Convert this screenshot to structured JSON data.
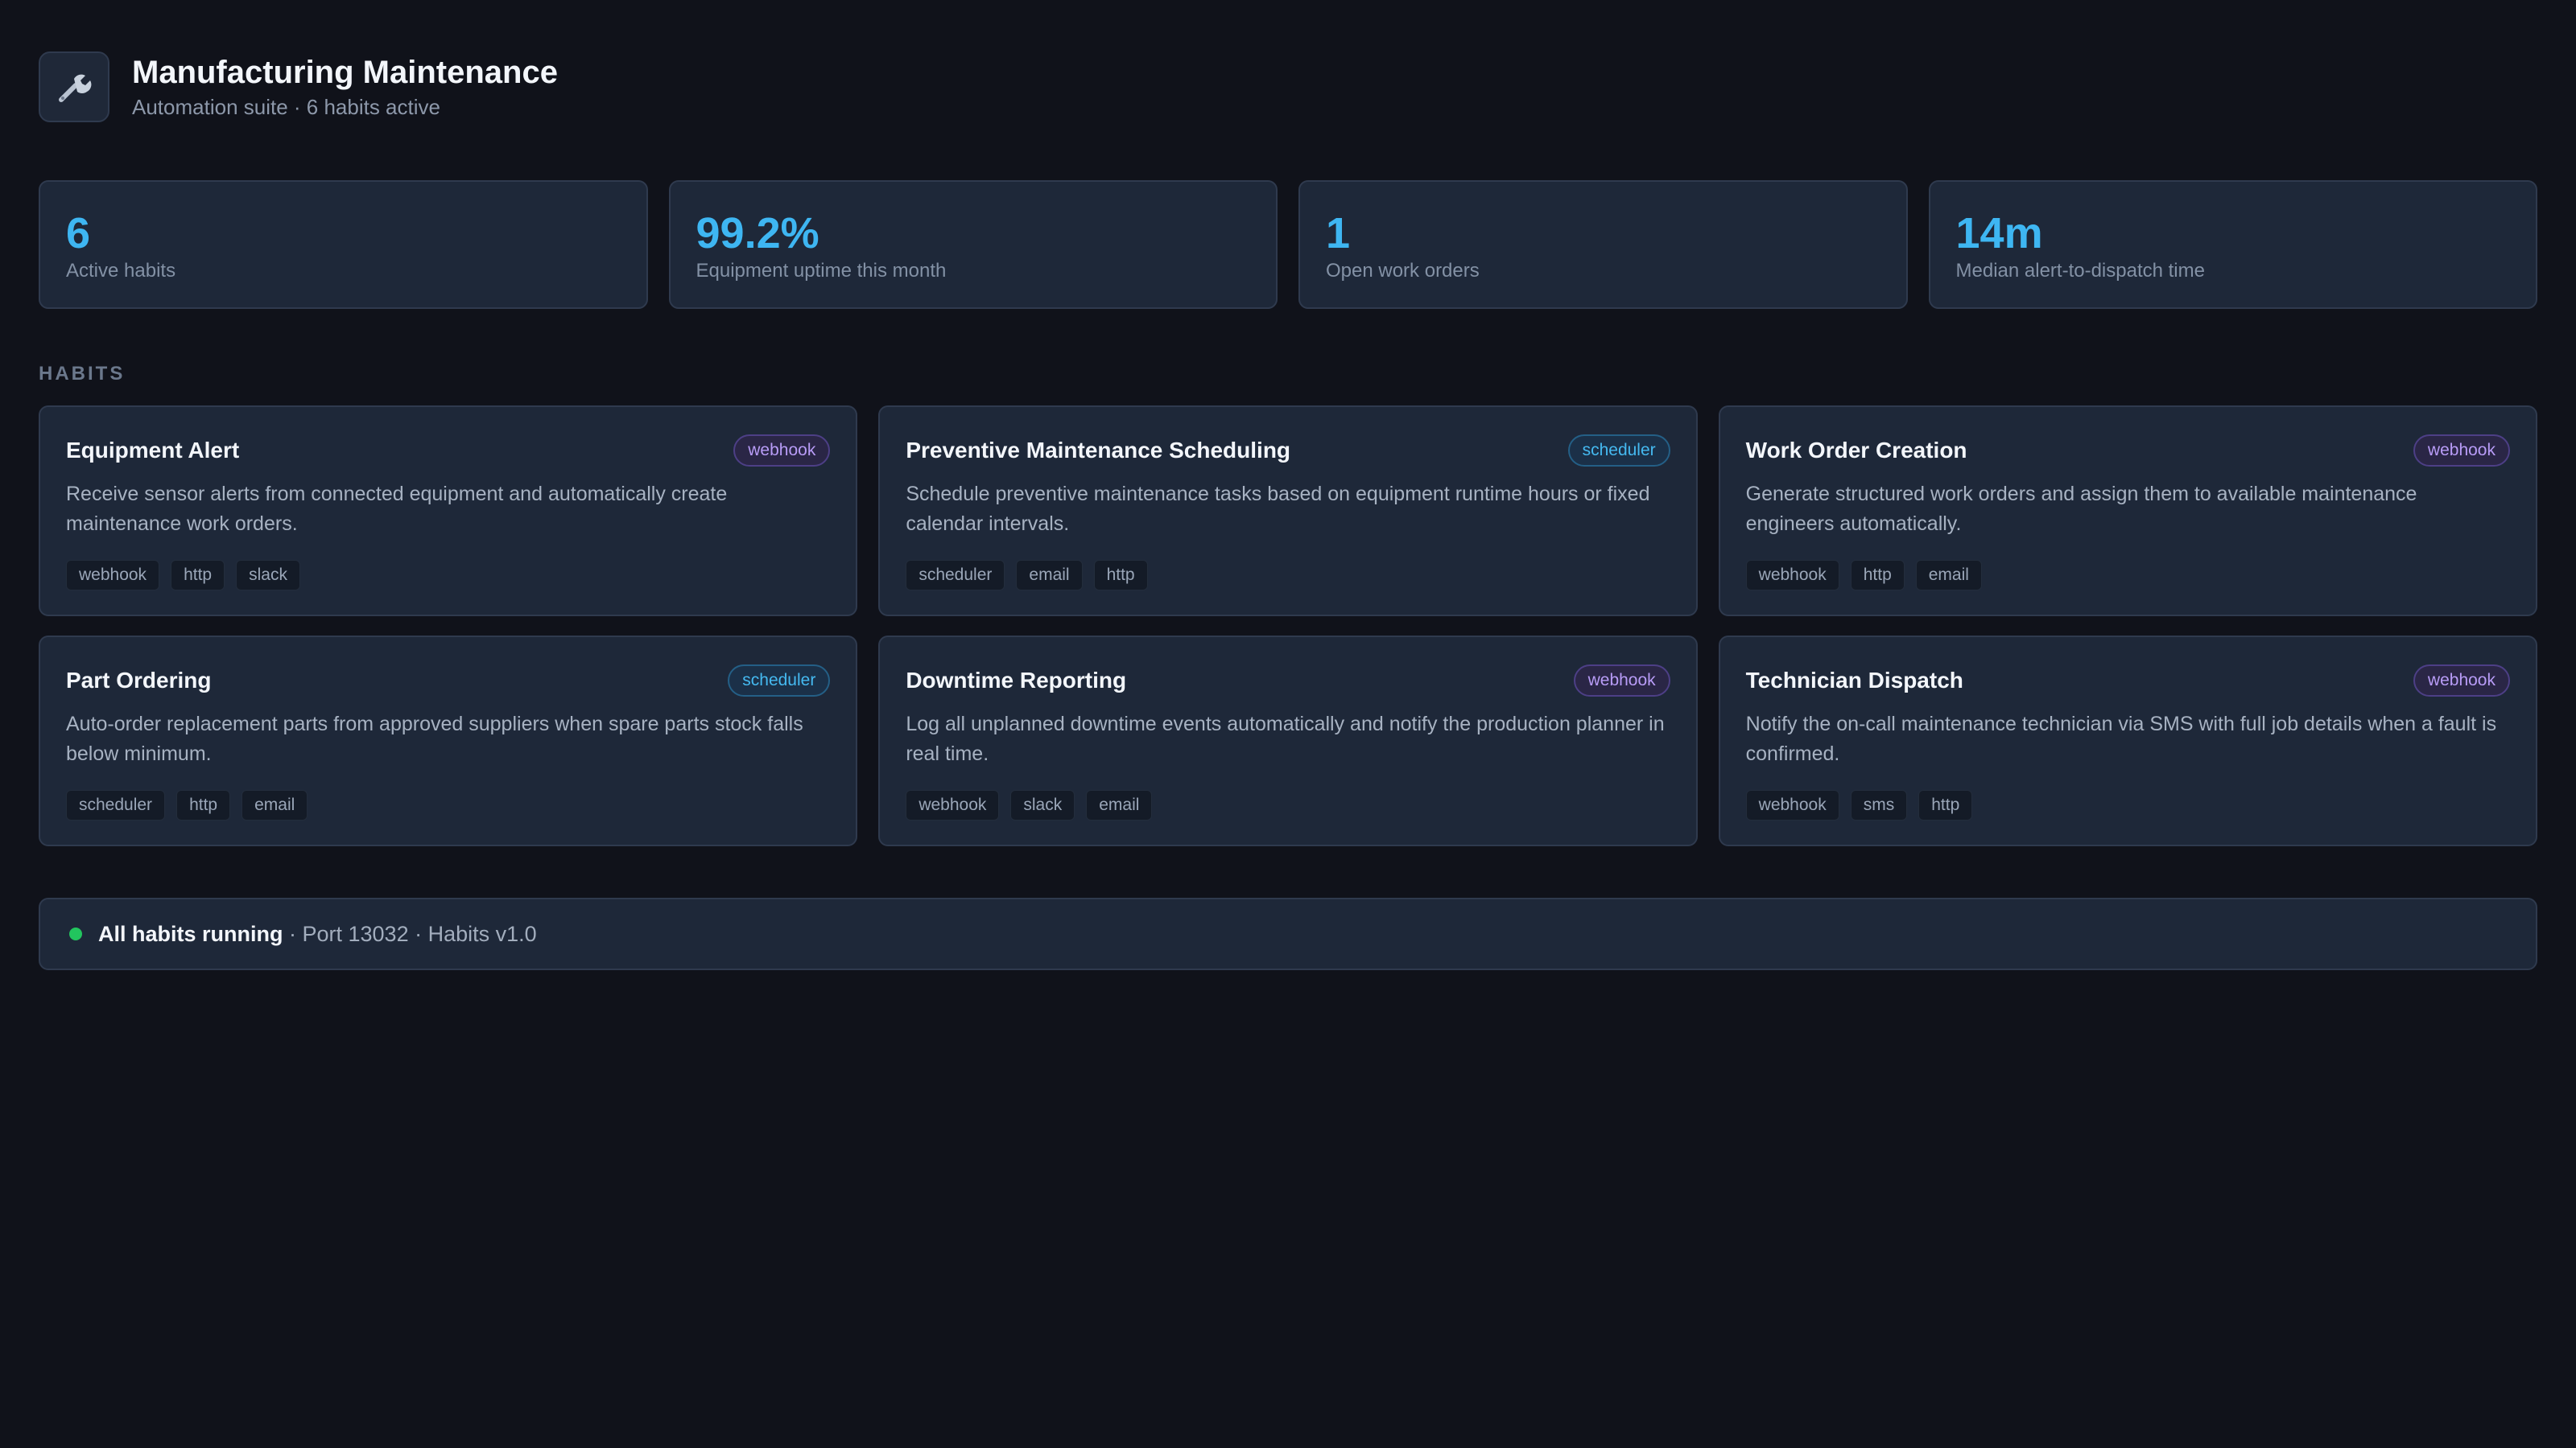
{
  "header": {
    "icon": "wrench-icon",
    "title": "Manufacturing Maintenance",
    "subtitle": "Automation suite · 6 habits active"
  },
  "stats": [
    {
      "value": "6",
      "label": "Active habits"
    },
    {
      "value": "99.2%",
      "label": "Equipment uptime this month"
    },
    {
      "value": "1",
      "label": "Open work orders"
    },
    {
      "value": "14m",
      "label": "Median alert-to-dispatch time"
    }
  ],
  "section_label": "HABITS",
  "habits": [
    {
      "title": "Equipment Alert",
      "trigger": "webhook",
      "description": "Receive sensor alerts from connected equipment and automatically create maintenance work orders.",
      "tags": [
        "webhook",
        "http",
        "slack"
      ]
    },
    {
      "title": "Preventive Maintenance Scheduling",
      "trigger": "scheduler",
      "description": "Schedule preventive maintenance tasks based on equipment runtime hours or fixed calendar intervals.",
      "tags": [
        "scheduler",
        "email",
        "http"
      ]
    },
    {
      "title": "Work Order Creation",
      "trigger": "webhook",
      "description": "Generate structured work orders and assign them to available maintenance engineers automatically.",
      "tags": [
        "webhook",
        "http",
        "email"
      ]
    },
    {
      "title": "Part Ordering",
      "trigger": "scheduler",
      "description": "Auto-order replacement parts from approved suppliers when spare parts stock falls below minimum.",
      "tags": [
        "scheduler",
        "http",
        "email"
      ]
    },
    {
      "title": "Downtime Reporting",
      "trigger": "webhook",
      "description": "Log all unplanned downtime events automatically and notify the production planner in real time.",
      "tags": [
        "webhook",
        "slack",
        "email"
      ]
    },
    {
      "title": "Technician Dispatch",
      "trigger": "webhook",
      "description": "Notify the on-call maintenance technician via SMS with full job details when a fault is confirmed.",
      "tags": [
        "webhook",
        "sms",
        "http"
      ]
    }
  ],
  "status": {
    "strong": "All habits running",
    "detail": " · Port 13032 · Habits v1.0",
    "color": "#22c55e"
  },
  "colors": {
    "accent": "#3eb6f2",
    "webhook": "#b89cf7",
    "scheduler": "#45b9f0"
  }
}
